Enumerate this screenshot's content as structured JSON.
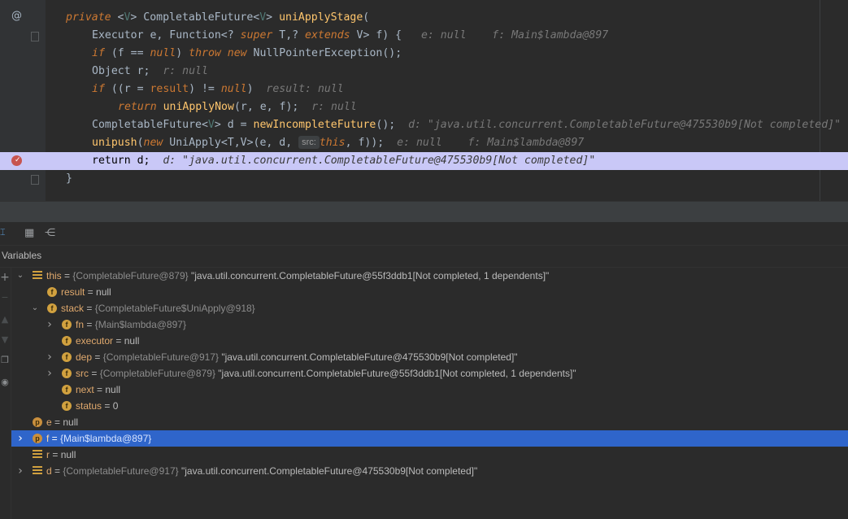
{
  "colors": {
    "editor_bg": "#2b2b2b",
    "gutter_bg": "#313335",
    "highlight_line": "#c9c8f7",
    "selected_row": "#2f65ca",
    "keyword": "#cc7832",
    "method": "#ffc66d",
    "hint": "#787878",
    "breakpoint": "#c75450"
  },
  "editor": {
    "gutter_icons": {
      "at": "@",
      "breakpoint": "breakpoint-icon"
    },
    "lines": [
      {
        "kw1": "private",
        "t1": " <",
        "tp1": "V",
        "t2": "> CompletableFuture<",
        "tp2": "V",
        "t3": "> ",
        "fn": "uniApplyStage",
        "t4": "("
      },
      {
        "t1": "Executor e, Function<? ",
        "kw1": "super",
        "t2": " T,? ",
        "kw2": "extends",
        "t3": " V> f) {",
        "hint": "e: null    f: Main$lambda@897"
      },
      {
        "kw1": "if",
        "t1": " (f == ",
        "kw2": "null",
        "t2": ") ",
        "kw3": "throw",
        "t3": " ",
        "kw4": "new",
        "t4": " NullPointerException();"
      },
      {
        "t1": "Object r;",
        "hint": "r: null"
      },
      {
        "kw1": "if",
        "t1": " ((r = ",
        "fld": "result",
        "t2": ") != ",
        "kw2": "null",
        "t3": ")",
        "hint": "result: null"
      },
      {
        "kw1": "return",
        "t1": " ",
        "fn": "uniApplyNow",
        "t2": "(r, e, f);",
        "hint": "r: null"
      },
      {
        "t1": "CompletableFuture<",
        "tp": "V",
        "t2": "> d = ",
        "fn": "newIncompleteFuture",
        "t3": "();",
        "hint": "d: \"java.util.concurrent.CompletableFuture@475530b9[Not completed]\""
      },
      {
        "fn": "unipush",
        "t1": "(",
        "kw1": "new",
        "t2": " UniApply<T,V>(e, d, ",
        "chip": "src:",
        "kw2": "this",
        "t3": ", f));",
        "hint": "e: null    f: Main$lambda@897"
      },
      {
        "kw1": "return",
        "t1": " d;",
        "hint": "d: \"java.util.concurrent.CompletableFuture@475530b9[Not completed]\""
      },
      {
        "t1": "}"
      }
    ]
  },
  "panel": {
    "title": "Variables",
    "toolbar_icons": [
      "text-cursor-icon",
      "table-icon",
      "flow-icon"
    ]
  },
  "variables": [
    {
      "icon": "bars",
      "name": "this",
      "ref": "{CompletableFuture@879}",
      "value": "\"java.util.concurrent.CompletableFuture@55f3ddb1[Not completed, 1 dependents]\"",
      "expanded": true
    },
    {
      "icon": "f",
      "name": "result",
      "value": "null"
    },
    {
      "icon": "f",
      "name": "stack",
      "ref": "{CompletableFuture$UniApply@918}",
      "expanded": true
    },
    {
      "icon": "f",
      "name": "fn",
      "ref": "{Main$lambda@897}",
      "expanded": false
    },
    {
      "icon": "f",
      "name": "executor",
      "value": "null"
    },
    {
      "icon": "f",
      "name": "dep",
      "ref": "{CompletableFuture@917}",
      "value": "\"java.util.concurrent.CompletableFuture@475530b9[Not completed]\"",
      "expanded": false
    },
    {
      "icon": "f",
      "name": "src",
      "ref": "{CompletableFuture@879}",
      "value": "\"java.util.concurrent.CompletableFuture@55f3ddb1[Not completed, 1 dependents]\"",
      "expanded": false
    },
    {
      "icon": "f",
      "name": "next",
      "value": "null"
    },
    {
      "icon": "f",
      "name": "status",
      "value": "0"
    },
    {
      "icon": "p",
      "name": "e",
      "value": "null"
    },
    {
      "icon": "p",
      "name": "f",
      "ref": "{Main$lambda@897}",
      "expanded": false,
      "selected": true
    },
    {
      "icon": "bars",
      "name": "r",
      "value": "null"
    },
    {
      "icon": "bars",
      "name": "d",
      "ref": "{CompletableFuture@917}",
      "value": "\"java.util.concurrent.CompletableFuture@475530b9[Not completed]\"",
      "expanded": false
    }
  ]
}
